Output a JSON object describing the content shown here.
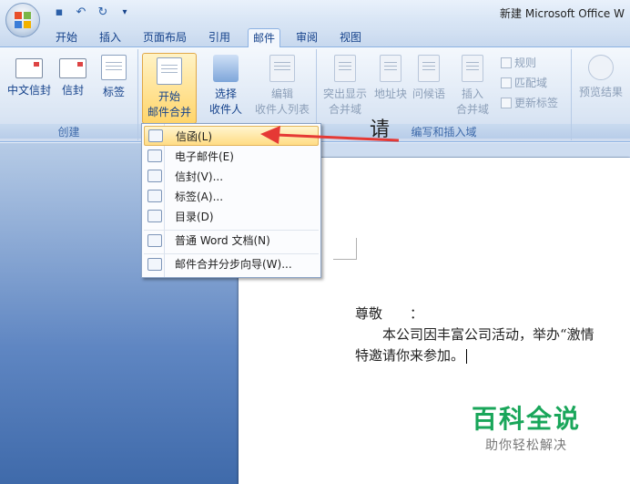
{
  "window": {
    "title": "新建 Microsoft Office W"
  },
  "tabs": [
    "开始",
    "插入",
    "页面布局",
    "引用",
    "邮件",
    "审阅",
    "视图"
  ],
  "active_tab": "邮件",
  "ribbon": {
    "create_group": {
      "label": "创建",
      "buttons": [
        "中文信封",
        "信封",
        "标签"
      ]
    },
    "start_group": {
      "start_merge": {
        "line1": "开始",
        "line2": "邮件合并"
      },
      "select_recipients": {
        "line1": "选择",
        "line2": "收件人"
      },
      "edit_list": {
        "line1": "编辑",
        "line2": "收件人列表"
      }
    },
    "write_group": {
      "label": "编写和插入域",
      "highlight_fields": {
        "line1": "突出显示",
        "line2": "合并域"
      },
      "address_block": "地址块",
      "greeting_line": "问候语",
      "insert_field": {
        "line1": "插入",
        "line2": "合并域"
      },
      "rules": "规则",
      "match_fields": "匹配域",
      "update_labels": "更新标签"
    },
    "preview": {
      "label": "预览结果"
    }
  },
  "dropdown": {
    "items": [
      {
        "label": "信函(L)",
        "name": "letter"
      },
      {
        "label": "电子邮件(E)",
        "name": "email"
      },
      {
        "label": "信封(V)...",
        "name": "envelope"
      },
      {
        "label": "标签(A)...",
        "name": "label"
      },
      {
        "label": "目录(D)",
        "name": "directory"
      },
      {
        "label": "普通 Word 文档(N)",
        "name": "normal-doc"
      },
      {
        "label": "邮件合并分步向导(W)...",
        "name": "wizard"
      }
    ]
  },
  "document": {
    "heading": "请",
    "salutation": "尊敬　　：",
    "body_line1": "　　本公司因丰富公司活动，举办“激情",
    "body_line2": "特邀请你来参加。"
  },
  "watermark": {
    "title": "百科全说",
    "subtitle": "助你轻松解决"
  },
  "colors": {
    "accent": "#15428b",
    "highlight": "#ffd56b",
    "arrow": "#e53935",
    "watermark": "#19a65a"
  }
}
